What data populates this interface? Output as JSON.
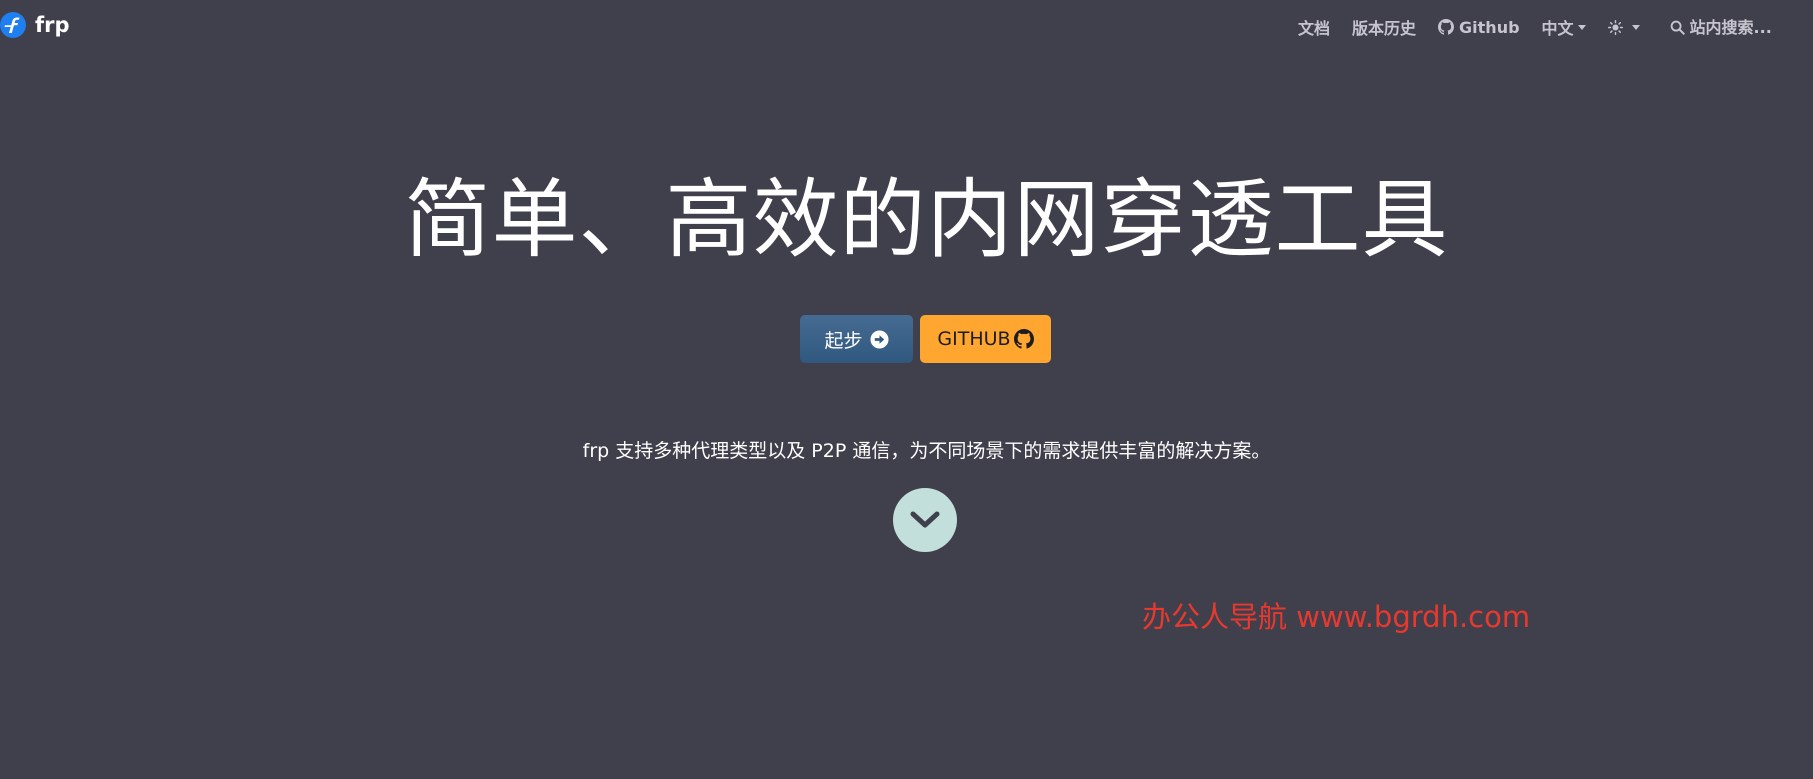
{
  "navbar": {
    "brand": {
      "name": "frp",
      "logo_icon": "frp-logo-icon",
      "logo_color": "#1f7ef0"
    },
    "links": [
      {
        "label": "文档"
      },
      {
        "label": "版本历史"
      },
      {
        "label": "Github",
        "icon": "github-icon"
      },
      {
        "label": "中文",
        "icon": "chevron-down-icon"
      }
    ],
    "theme_toggle": {
      "icon": "sun-icon"
    },
    "search": {
      "placeholder": "站内搜索...",
      "value": "",
      "icon": "search-icon"
    },
    "text_color": "#c6c5cf"
  },
  "hero": {
    "title": "简单、高效的内网穿透工具",
    "buttons": {
      "start_label": "起步",
      "start_icon": "arrow-circle-right-icon",
      "start_color": "#3b628a",
      "github_label": "GITHUB",
      "github_icon": "github-icon",
      "github_color": "#ffa630"
    },
    "lead": "frp 支持多种代理类型以及 P2P 通信，为不同场景下的需求提供丰富的解决方案。",
    "scroll_icon": "chevron-down-icon",
    "scroll_color": "#c2dfdc"
  },
  "watermark": {
    "text": "办公人导航  www.bgrdh.com",
    "color": "#e8392f"
  },
  "colors": {
    "background": "#403f4c"
  }
}
